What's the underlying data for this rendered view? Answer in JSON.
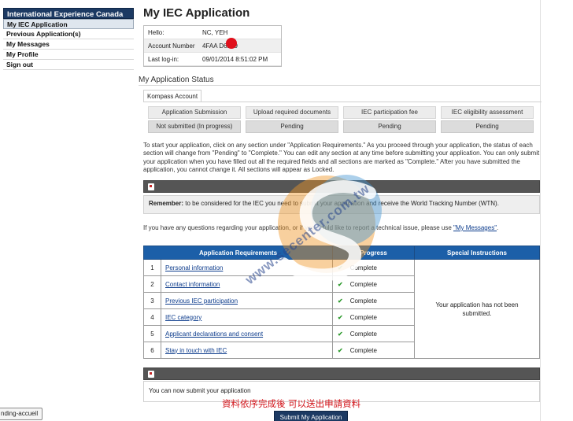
{
  "sidebar": {
    "title": "International Experience Canada",
    "items": [
      {
        "label": "My IEC Application",
        "active": true
      },
      {
        "label": "Previous Application(s)",
        "active": false
      },
      {
        "label": "My Messages",
        "active": false
      },
      {
        "label": "My Profile",
        "active": false
      },
      {
        "label": "Sign out",
        "active": false
      }
    ]
  },
  "main": {
    "title": "My IEC Application",
    "info": {
      "hello_label": "Hello:",
      "hello_value": "NC, YEH",
      "account_label": "Account Number",
      "account_value": "4FAA     D6249",
      "login_label": "Last log-in:",
      "login_value": "09/01/2014 8:51:02 PM"
    },
    "status_heading": "My Application Status",
    "tab_label": "Kompass Account",
    "steps": [
      {
        "name": "Application Submission",
        "status": "Not submitted (In progress)"
      },
      {
        "name": "Upload required documents",
        "status": "Pending"
      },
      {
        "name": "IEC participation fee",
        "status": "Pending"
      },
      {
        "name": "IEC eligibility assessment",
        "status": "Pending"
      }
    ],
    "intro": "To start your application, click on any section under \"Application Requirements.\" As you proceed through your application, the status of each section will change from \"Pending\" to \"Complete.\" You can edit any section at any time before submitting your application. You can only submit your application when you have filled out all the required fields and all sections are marked as \"Complete.\" After you have submitted the application, you cannot change it. All sections will appear as Locked.",
    "remember_label": "Remember:",
    "remember_text": " to be considered for the IEC you need to submit your application and receive the World Tracking Number (WTN).",
    "questions_text": "If you have any questions regarding your application, or if you would like to report a technical issue, please use ",
    "questions_link": "\"My Messages\"",
    "questions_end": ".",
    "table": {
      "col_requirements": "Application Requirements",
      "col_progress": "Progress",
      "col_special": "Special Instructions",
      "special_text": "Your application has not been submitted.",
      "rows": [
        {
          "num": "1",
          "name": "Personal information",
          "progress": "Complete"
        },
        {
          "num": "2",
          "name": "Contact information",
          "progress": "Complete"
        },
        {
          "num": "3",
          "name": "Previous IEC participation",
          "progress": "Complete"
        },
        {
          "num": "4",
          "name": "IEC category",
          "progress": "Complete"
        },
        {
          "num": "5",
          "name": "Applicant declarations and consent",
          "progress": "Complete"
        },
        {
          "num": "6",
          "name": "Stay in touch with IEC",
          "progress": "Complete"
        }
      ]
    },
    "submit_area_text": "You can now submit your application",
    "chinese_note": "資料依序完成後 可以送出申請資料",
    "submit_button": "Submit My Application"
  },
  "watermark": {
    "text": "www.secenter.com.tw"
  },
  "status_tooltip": "nding-accueil",
  "colors": {
    "sidebar_header": "#1c3a63",
    "table_header": "#1c5fa8",
    "dark_bar": "#555555",
    "check": "#2c9a2c",
    "note_red": "#d2141a"
  }
}
